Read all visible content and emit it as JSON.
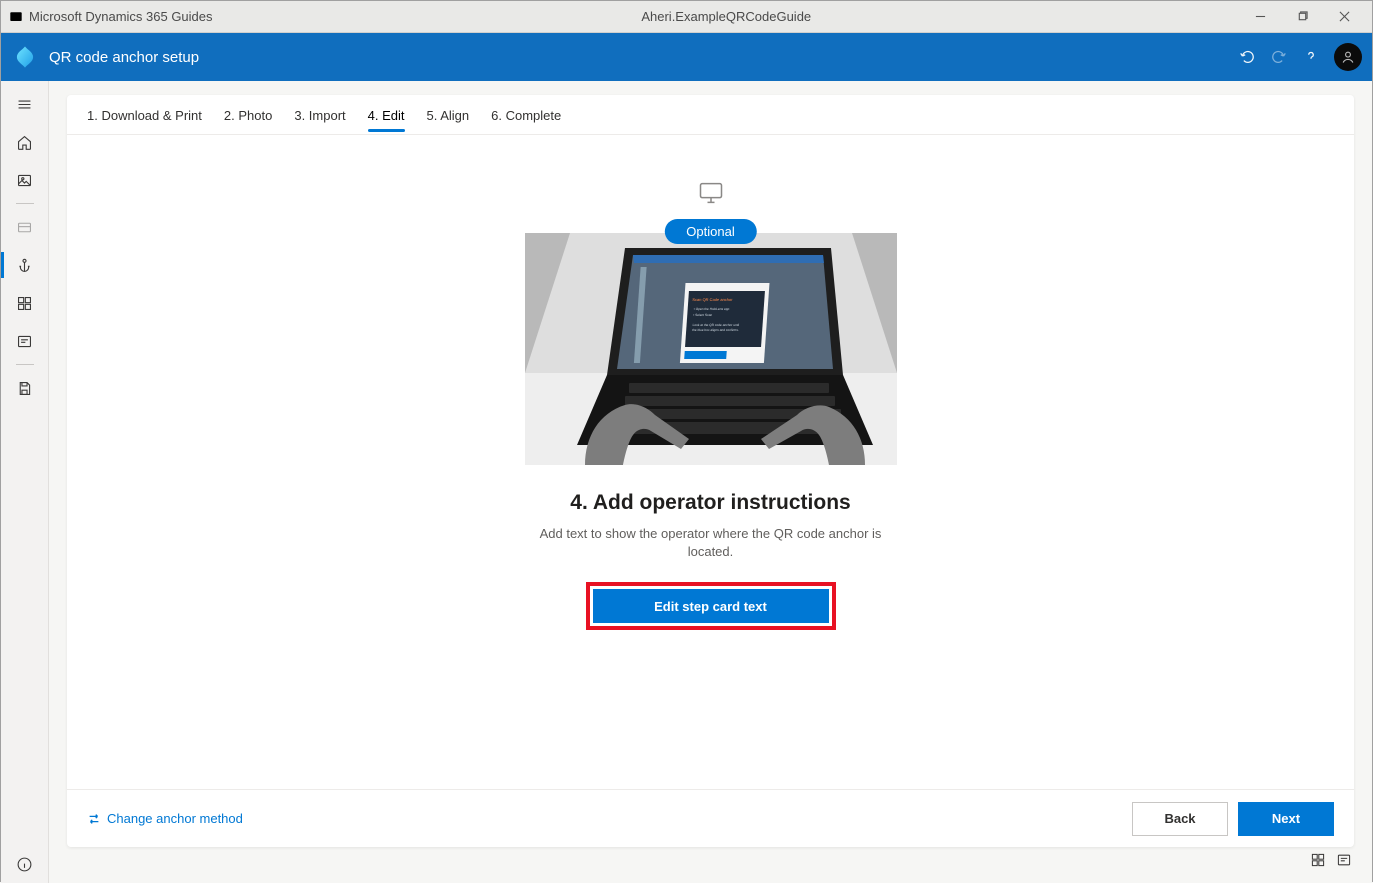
{
  "window": {
    "app_name": "Microsoft Dynamics 365 Guides",
    "document": "Aheri.ExampleQRCodeGuide"
  },
  "cmdbar": {
    "title": "QR code anchor setup"
  },
  "tabs": [
    {
      "label": "1. Download & Print"
    },
    {
      "label": "2. Photo"
    },
    {
      "label": "3. Import"
    },
    {
      "label": "4. Edit",
      "active": true
    },
    {
      "label": "5. Align"
    },
    {
      "label": "6. Complete"
    }
  ],
  "step": {
    "badge": "Optional",
    "title": "4. Add operator instructions",
    "subtitle": "Add text to show the operator where the QR code anchor is located.",
    "button": "Edit step card text"
  },
  "bottom": {
    "change_link": "Change anchor method",
    "back": "Back",
    "next": "Next"
  }
}
